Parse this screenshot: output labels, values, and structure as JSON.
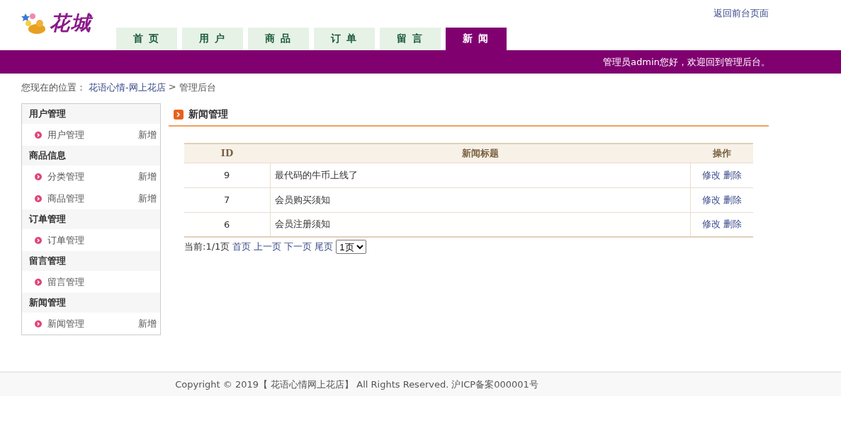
{
  "logo": {
    "text": "花城"
  },
  "top_link": "返回前台页面",
  "nav": [
    {
      "label": "首 页",
      "selected": false
    },
    {
      "label": "用 户",
      "selected": false
    },
    {
      "label": "商 品",
      "selected": false
    },
    {
      "label": "订 单",
      "selected": false
    },
    {
      "label": "留 言",
      "selected": false
    },
    {
      "label": "新 闻",
      "selected": true
    }
  ],
  "welcome": "管理员admin您好，欢迎回到管理后台。",
  "breadcrumb": {
    "prefix": "您现在的位置：",
    "link": "花语心情-网上花店",
    "separator": ">",
    "current": "管理后台"
  },
  "sidebar": [
    {
      "title": "用户管理",
      "items": [
        {
          "label": "用户管理",
          "action": "新增"
        }
      ]
    },
    {
      "title": "商品信息",
      "items": [
        {
          "label": "分类管理",
          "action": "新增"
        },
        {
          "label": "商品管理",
          "action": "新增"
        }
      ]
    },
    {
      "title": "订单管理",
      "items": [
        {
          "label": "订单管理"
        }
      ]
    },
    {
      "title": "留言管理",
      "items": [
        {
          "label": "留言管理"
        }
      ]
    },
    {
      "title": "新闻管理",
      "items": [
        {
          "label": "新闻管理",
          "action": "新增"
        }
      ]
    }
  ],
  "section_title": "新闻管理",
  "table": {
    "columns": [
      "ID",
      "新闻标题",
      "操作"
    ],
    "rows": [
      {
        "id": "9",
        "title": "最代码的牛币上线了",
        "actions": [
          "修改",
          "删除"
        ]
      },
      {
        "id": "7",
        "title": "会员购买须知",
        "actions": [
          "修改",
          "删除"
        ]
      },
      {
        "id": "6",
        "title": "会员注册须知",
        "actions": [
          "修改",
          "删除"
        ]
      }
    ]
  },
  "pagination": {
    "status": "当前:1/1页",
    "links": [
      "首页",
      "上一页",
      "下一页",
      "尾页"
    ],
    "page_select": "1页"
  },
  "footer": "Copyright © 2019【 花语心情网上花店】 All Rights Reserved. 沪ICP备案000001号"
}
